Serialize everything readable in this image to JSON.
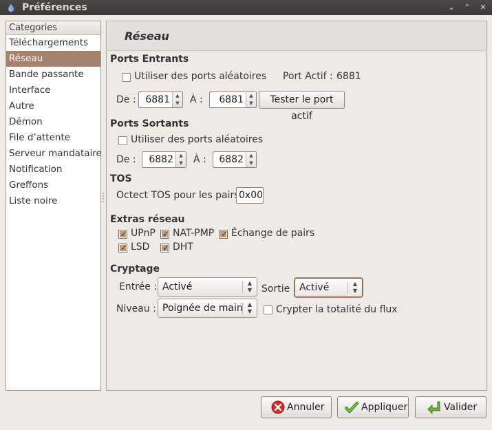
{
  "window": {
    "title": "Préférences"
  },
  "sidebar": {
    "header": "Categories",
    "items": [
      {
        "label": "Téléchargements",
        "selected": false
      },
      {
        "label": "Réseau",
        "selected": true
      },
      {
        "label": "Bande passante",
        "selected": false
      },
      {
        "label": "Interface",
        "selected": false
      },
      {
        "label": "Autre",
        "selected": false
      },
      {
        "label": "Démon",
        "selected": false
      },
      {
        "label": "File d’attente",
        "selected": false
      },
      {
        "label": "Serveur mandataire",
        "selected": false
      },
      {
        "label": "Notification",
        "selected": false
      },
      {
        "label": "Greffons",
        "selected": false
      },
      {
        "label": "Liste noire",
        "selected": false
      }
    ]
  },
  "page": {
    "title": "Réseau"
  },
  "incoming": {
    "title": "Ports Entrants",
    "random_ports_label": "Utiliser des ports aléatoires",
    "random_ports_checked": false,
    "active_port_label": "Port Actif :",
    "active_port_value": "6881",
    "from_label": "De :",
    "from_value": "6881",
    "to_label": "À :",
    "to_value": "6881",
    "test_button": "Tester le port actif"
  },
  "outgoing": {
    "title": "Ports Sortants",
    "random_ports_label": "Utiliser des ports aléatoires",
    "random_ports_checked": false,
    "from_label": "De :",
    "from_value": "6882",
    "to_label": "À :",
    "to_value": "6882"
  },
  "tos": {
    "title": "TOS",
    "label": "Octect TOS pour les pairs:",
    "value": "0x00"
  },
  "extras": {
    "title": "Extras réseau",
    "upnp": {
      "label": "UPnP",
      "checked": true
    },
    "natpmp": {
      "label": "NAT-PMP",
      "checked": true
    },
    "pex": {
      "label": "Échange de pairs",
      "checked": true
    },
    "lsd": {
      "label": "LSD",
      "checked": true
    },
    "dht": {
      "label": "DHT",
      "checked": true
    }
  },
  "encryption": {
    "title": "Cryptage",
    "inbound_label": "Entrée :",
    "inbound_value": "Activé",
    "outbound_label": "Sortie :",
    "outbound_value": "Activé",
    "level_label": "Niveau :",
    "level_value": "Poignée de main",
    "full_stream_label": "Crypter la totalité du flux",
    "full_stream_checked": false
  },
  "buttons": {
    "cancel": "Annuler",
    "apply": "Appliquer",
    "ok": "Valider"
  },
  "colors": {
    "selection": "#a6826c",
    "check_fill": "#c49a7d",
    "cancel_icon": "#d9252b",
    "ok_icon": "#5aa02c"
  }
}
